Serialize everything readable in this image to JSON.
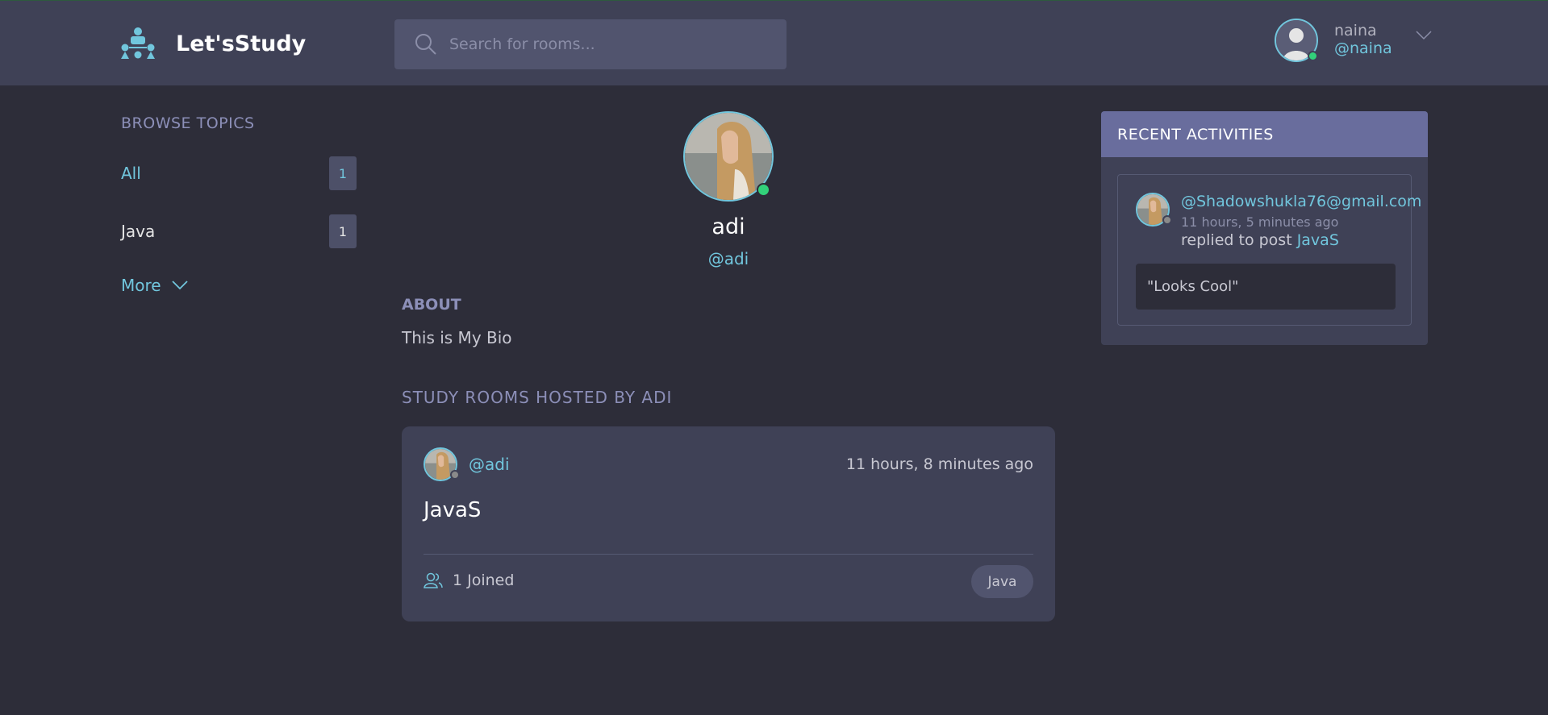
{
  "header": {
    "app_name": "Let'sStudy",
    "search_placeholder": "Search for rooms...",
    "user": {
      "name": "naina",
      "handle": "@naina",
      "status": "online"
    }
  },
  "sidebar": {
    "title": "BROWSE TOPICS",
    "topics": [
      {
        "label": "All",
        "count": "1",
        "active": true
      },
      {
        "label": "Java",
        "count": "1",
        "active": false
      }
    ],
    "more_label": "More"
  },
  "profile": {
    "name": "adi",
    "handle": "@adi",
    "about_title": "ABOUT",
    "bio": "This is My Bio",
    "rooms_title": "STUDY ROOMS HOSTED BY ADI",
    "rooms": [
      {
        "host": "@adi",
        "time": "11 hours, 8 minutes ago",
        "title": "JavaS",
        "joined": "1 Joined",
        "topic": "Java"
      }
    ]
  },
  "activities": {
    "title": "RECENT ACTIVITIES",
    "items": [
      {
        "user": "@Shadowshukla76@gmail.com",
        "time": "11 hours, 5 minutes ago",
        "action": "replied to post",
        "post": "JavaS",
        "quote": "\"Looks Cool\""
      }
    ]
  },
  "colors": {
    "background": "#2d2d39",
    "panel": "#3f4156",
    "accent": "#71c6dd",
    "muted_heading": "#8c8fb8",
    "activities_header": "#696d9d",
    "online": "#32d17a"
  }
}
